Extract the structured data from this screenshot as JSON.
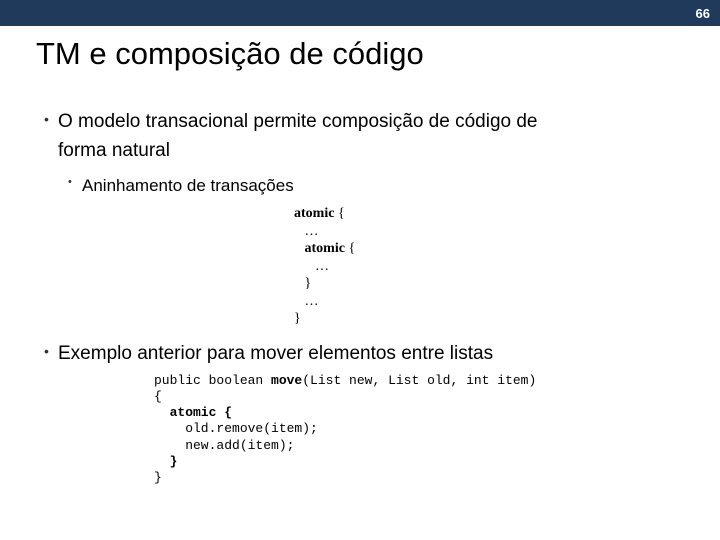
{
  "header": {
    "page_number": "66"
  },
  "title": "TM e composição de código",
  "bullets": {
    "b1_line1": "O modelo transacional permite composição de código de",
    "b1_line2": "forma natural",
    "b2": "Aninhamento de transações",
    "b3": "Exemplo anterior para mover elementos entre listas"
  },
  "code1": {
    "l1a": "atomic",
    "l1b": " {",
    "l2": "   …",
    "l3a": "   atomic",
    "l3b": " {",
    "l4": "      …",
    "l5": "   }",
    "l6": "   …",
    "l7": "}"
  },
  "code2": {
    "l1a": "public boolean ",
    "l1b": "move",
    "l1c": "(List new, List old, int item)",
    "l2": "{",
    "l3": "  atomic {",
    "l4": "    old.remove(item);",
    "l5": "    new.add(item);",
    "l6": "  }",
    "l7": "}"
  }
}
